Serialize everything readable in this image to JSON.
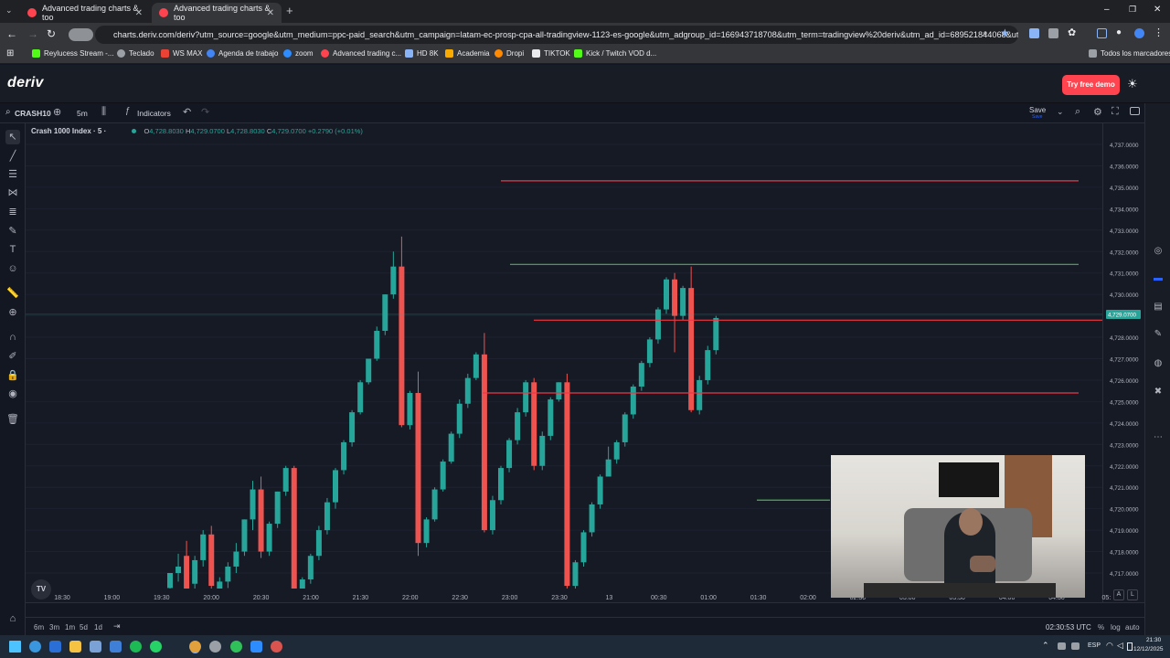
{
  "browser": {
    "tabs": [
      {
        "title": "Advanced trading charts & too",
        "active": false
      },
      {
        "title": "Advanced trading charts & too",
        "active": true
      }
    ],
    "url": "charts.deriv.com/deriv?utm_source=google&utm_medium=ppc-paid_search&utm_campaign=latam-ec-prosp-cpa-all-tradingview-1123-es-google&utm_adgroup_id=166943718708&utm_term=tradingview%20deriv&utm_ad_id=689521844068&utm_cam...",
    "bookmarks": [
      {
        "label": "Reylucess Stream -...",
        "color": "#53fc18"
      },
      {
        "label": "Teclado",
        "color": "#9aa0a6"
      },
      {
        "label": "WS MAX",
        "color": "#ea4335"
      },
      {
        "label": "Agenda de trabajo",
        "color": "#4285f4"
      },
      {
        "label": "zoom",
        "color": "#2d8cff"
      },
      {
        "label": "Advanced trading c...",
        "color": "#ff444f"
      },
      {
        "label": "HD 8K",
        "color": "#8ab4f8"
      },
      {
        "label": "Academia",
        "color": "#f9ab00"
      },
      {
        "label": "Dropi",
        "color": "#ff8a00"
      },
      {
        "label": "TIKTOK",
        "color": "#e8eaed"
      },
      {
        "label": "Kick / Twitch VOD d...",
        "color": "#53fc18"
      }
    ],
    "all_bookmarks": "Todos los marcadores"
  },
  "app": {
    "logo": "deriv",
    "try_demo": "Try free demo"
  },
  "toolbar": {
    "symbol": "CRASH10",
    "interval": "5m",
    "indicators": "Indicators",
    "save": "Save",
    "save_sub": "Save"
  },
  "legend": {
    "name": "Crash 1000 Index · 5 ·",
    "o_label": "O",
    "o": "4,728.8030",
    "h_label": "H",
    "h": "4,729.0700",
    "l_label": "L",
    "l": "4,728.8030",
    "c_label": "C",
    "c": "4,729.0700",
    "change": "+0.2790 (+0.01%)"
  },
  "chart_data": {
    "type": "candlestick",
    "price_labels": [
      "4,737.0000",
      "4,736.0000",
      "4,735.0000",
      "4,734.0000",
      "4,733.0000",
      "4,732.0000",
      "4,731.0000",
      "4,730.0000",
      "4,729.0000",
      "4,728.0000",
      "4,727.0000",
      "4,726.0000",
      "4,725.0000",
      "4,724.0000",
      "4,723.0000",
      "4,722.0000",
      "4,721.0000",
      "4,720.0000",
      "4,719.0000",
      "4,718.0000",
      "4,717.0000"
    ],
    "last_price": "4,729.0700",
    "time_labels": [
      "18:30",
      "19:00",
      "19:30",
      "20:00",
      "20:30",
      "21:00",
      "21:30",
      "22:00",
      "22:30",
      "23:00",
      "23:30",
      "13",
      "00:30",
      "01:00",
      "01:30",
      "02:00",
      "02:30",
      "03:00",
      "03:30",
      "04:00",
      "04:30",
      "05:"
    ],
    "candles": [
      [
        4716.3,
        4717.0,
        4716.0,
        4717.0
      ],
      [
        4717.0,
        4717.9,
        4716.6,
        4717.3
      ],
      [
        4717.8,
        4718.5,
        4716.1,
        4716.2
      ],
      [
        4716.5,
        4717.8,
        4716.0,
        4717.6
      ],
      [
        4717.6,
        4719.0,
        4717.3,
        4718.8
      ],
      [
        4718.8,
        4719.2,
        4716.2,
        4716.4
      ],
      [
        4716.0,
        4716.8,
        4715.8,
        4716.6
      ],
      [
        4716.6,
        4717.5,
        4716.3,
        4717.3
      ],
      [
        4717.3,
        4718.4,
        4717.0,
        4718.0
      ],
      [
        4718.0,
        4719.5,
        4717.8,
        4719.5
      ],
      [
        4719.5,
        4721.3,
        4719.0,
        4720.9
      ],
      [
        4720.9,
        4721.5,
        4717.7,
        4718.0
      ],
      [
        4718.0,
        4719.4,
        4717.8,
        4719.3
      ],
      [
        4719.3,
        4720.8,
        4719.1,
        4720.8
      ],
      [
        4720.8,
        4722.0,
        4720.6,
        4721.9
      ],
      [
        4721.9,
        4722.0,
        4715.6,
        4715.8
      ],
      [
        4716.2,
        4716.8,
        4716.0,
        4716.7
      ],
      [
        4716.7,
        4717.9,
        4716.5,
        4717.8
      ],
      [
        4717.8,
        4719.2,
        4717.6,
        4719.0
      ],
      [
        4719.0,
        4720.5,
        4718.8,
        4720.3
      ],
      [
        4720.3,
        4721.9,
        4720.0,
        4721.8
      ],
      [
        4721.8,
        4723.2,
        4721.6,
        4723.1
      ],
      [
        4723.1,
        4724.6,
        4722.9,
        4724.5
      ],
      [
        4724.5,
        4726.0,
        4724.4,
        4725.9
      ],
      [
        4725.9,
        4727.0,
        4725.8,
        4727.0
      ],
      [
        4727.0,
        4728.5,
        4726.9,
        4728.3
      ],
      [
        4728.3,
        4730.0,
        4728.1,
        4730.0
      ],
      [
        4730.0,
        4732.0,
        4729.8,
        4731.3
      ],
      [
        4731.3,
        4732.7,
        4723.8,
        4723.9
      ],
      [
        4723.9,
        4725.5,
        4723.7,
        4725.4
      ],
      [
        4725.4,
        4726.4,
        4717.8,
        4718.4
      ],
      [
        4718.4,
        4719.6,
        4718.2,
        4719.5
      ],
      [
        4719.5,
        4721.0,
        4719.4,
        4720.9
      ],
      [
        4720.9,
        4722.3,
        4720.8,
        4722.2
      ],
      [
        4722.2,
        4723.6,
        4722.1,
        4723.5
      ],
      [
        4723.5,
        4725.1,
        4723.3,
        4724.9
      ],
      [
        4724.9,
        4726.3,
        4724.7,
        4726.1
      ],
      [
        4726.1,
        4727.3,
        4726.0,
        4727.2
      ],
      [
        4727.2,
        4728.2,
        4718.9,
        4719.0
      ],
      [
        4719.0,
        4720.6,
        4718.8,
        4720.4
      ],
      [
        4720.4,
        4722.0,
        4720.2,
        4721.9
      ],
      [
        4721.9,
        4723.3,
        4721.7,
        4723.2
      ],
      [
        4723.2,
        4724.7,
        4723.0,
        4724.5
      ],
      [
        4724.5,
        4726.0,
        4724.3,
        4725.9
      ],
      [
        4725.9,
        4726.1,
        4721.8,
        4722.0
      ],
      [
        4722.0,
        4723.6,
        4721.8,
        4723.4
      ],
      [
        4723.4,
        4725.2,
        4723.2,
        4725.1
      ],
      [
        4725.1,
        4725.9,
        4725.0,
        4725.9
      ],
      [
        4725.9,
        4726.3,
        4716.2,
        4716.4
      ],
      [
        4716.4,
        4717.6,
        4716.2,
        4717.5
      ],
      [
        4717.5,
        4719.0,
        4717.3,
        4718.9
      ],
      [
        4718.9,
        4720.3,
        4718.7,
        4720.2
      ],
      [
        4720.2,
        4721.6,
        4720.0,
        4721.5
      ],
      [
        4721.5,
        4722.9,
        4722.0,
        4722.3
      ],
      [
        4722.3,
        4723.2,
        4722.1,
        4723.1
      ],
      [
        4723.1,
        4724.5,
        4722.9,
        4724.4
      ],
      [
        4724.4,
        4725.8,
        4724.2,
        4725.7
      ],
      [
        4725.7,
        4726.9,
        4725.5,
        4726.8
      ],
      [
        4726.8,
        4728.0,
        4726.6,
        4727.9
      ],
      [
        4727.9,
        4729.4,
        4727.7,
        4729.3
      ],
      [
        4729.3,
        4730.8,
        4729.1,
        4730.7
      ],
      [
        4730.7,
        4731.0,
        4727.3,
        4729.0
      ],
      [
        4729.0,
        4730.4,
        4728.8,
        4730.3
      ],
      [
        4730.3,
        4731.3,
        4724.5,
        4724.6
      ],
      [
        4724.6,
        4726.2,
        4724.4,
        4726.0
      ],
      [
        4726.0,
        4727.6,
        4725.8,
        4727.4
      ],
      [
        4727.4,
        4729.0,
        4727.2,
        4728.9
      ]
    ],
    "horizontal_lines": [
      {
        "price": 4735.3,
        "color": "#f23645"
      },
      {
        "price": 4731.4,
        "color": "#4caf50"
      },
      {
        "price": 4728.8,
        "color": "#f23645"
      },
      {
        "price": 4725.4,
        "color": "#f23645"
      },
      {
        "price": 4720.4,
        "color": "#4caf50"
      }
    ],
    "colors": {
      "up": "#26a69a",
      "down": "#ef5350",
      "bg": "#161a25",
      "grid": "#1e2230",
      "text": "#b2b5be"
    }
  },
  "bottombar": {
    "ranges": [
      "6m",
      "3m",
      "1m",
      "5d",
      "1d"
    ],
    "time": "02:30:53 UTC",
    "percent": "%",
    "log": "log",
    "auto": "auto",
    "corner_a": "A",
    "corner_l": "L"
  },
  "taskbar": {
    "lang": "ESP",
    "time": "21:30",
    "date": "12/12/2025"
  }
}
